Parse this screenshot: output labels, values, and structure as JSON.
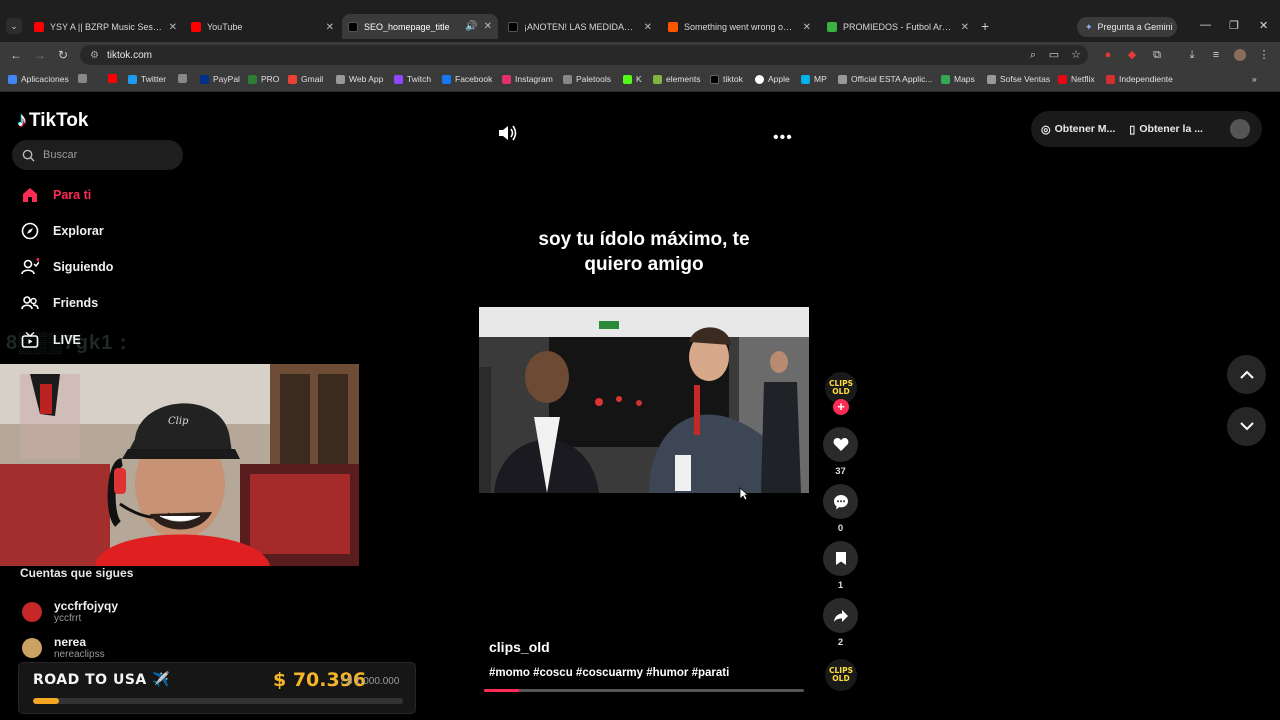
{
  "browser": {
    "tabs": [
      {
        "title": "YSY A || BZRP Music Sessions #...",
        "favicon_color": "#ff0000"
      },
      {
        "title": "YouTube",
        "favicon_color": "#ff0000"
      },
      {
        "title": "SEO_homepage_title",
        "favicon_color": "#000000",
        "active": true
      },
      {
        "title": "¡ANOTEN! LAS MEDIDAS QUE ...",
        "favicon_color": "#000000"
      },
      {
        "title": "Something went wrong on Sou...",
        "favicon_color": "#ff5500"
      },
      {
        "title": "PROMIEDOS - Futbol Argentino ...",
        "favicon_color": "#3cb043"
      }
    ],
    "new_tab": "+",
    "gemini_label": "Pregunta a Gemini",
    "url": "tiktok.com",
    "bookmarks": [
      {
        "label": "Aplicaciones",
        "color": "#4285f4"
      },
      {
        "label": "",
        "color": "#ff0000"
      },
      {
        "label": "Twitter",
        "color": "#1d9bf0"
      },
      {
        "label": "",
        "color": "#888888"
      },
      {
        "label": "PayPal",
        "color": "#003087"
      },
      {
        "label": "PRO",
        "color": "#2e7d32"
      },
      {
        "label": "Gmail",
        "color": "#ea4335"
      },
      {
        "label": "Web App",
        "color": "#999999"
      },
      {
        "label": "Twitch",
        "color": "#9146ff"
      },
      {
        "label": "Facebook",
        "color": "#1877f2"
      },
      {
        "label": "Instagram",
        "color": "#e1306c"
      },
      {
        "label": "Paletools",
        "color": "#888888"
      },
      {
        "label": "K",
        "color": "#53fc18"
      },
      {
        "label": "elements",
        "color": "#82b440"
      },
      {
        "label": "tiktok",
        "color": "#000000"
      },
      {
        "label": "Apple",
        "color": "#ffffff"
      },
      {
        "label": "MP",
        "color": "#00b1ea"
      },
      {
        "label": "Official ESTA Applic...",
        "color": "#999999"
      },
      {
        "label": "Maps",
        "color": "#34a853"
      },
      {
        "label": "Sofse Ventas",
        "color": "#999999"
      },
      {
        "label": "Netflix",
        "color": "#e50914"
      },
      {
        "label": "Independiente",
        "color": "#d32f2f"
      }
    ]
  },
  "sidebar": {
    "brand": "TikTok",
    "search_placeholder": "Buscar",
    "nav": [
      {
        "label": "Para ti",
        "icon": "home-icon"
      },
      {
        "label": "Explorar",
        "icon": "compass-icon"
      },
      {
        "label": "Siguiendo",
        "icon": "following-icon"
      },
      {
        "label": "Friends",
        "icon": "friends-icon"
      },
      {
        "label": "LIVE",
        "icon": "live-icon"
      }
    ],
    "ghost_overlay_text": "8▒▒▒7gk1 :",
    "following_title": "Cuentas que sigues",
    "following": [
      {
        "name": "yccfrfojyqy",
        "handle": "yccfrrt",
        "avatar_color": "#c62828"
      },
      {
        "name": "nerea",
        "handle": "nereaclipss",
        "avatar_color": "#c8a165"
      }
    ]
  },
  "stream_overlay": {
    "road_label": "ROAD TO USA ✈️",
    "amount": "$ 70.396",
    "goal": "/ $ 1.000.000",
    "progress_fraction": 0.07
  },
  "video": {
    "caption": "soy tu ídolo máximo, te quiero amigo",
    "author": "clips_old",
    "hashtags": "#momo #coscu #coscuarmy #humor #parati",
    "progress_fraction": 0.11,
    "creator_badge": "CLIPS OLD",
    "follow_plus": "+",
    "actions": [
      {
        "icon": "heart-icon",
        "count": "37"
      },
      {
        "icon": "comment-icon",
        "count": "0"
      },
      {
        "icon": "bookmark-icon",
        "count": "1"
      },
      {
        "icon": "share-icon",
        "count": "2"
      }
    ]
  },
  "topbar": {
    "get_coins": "Obtener M...",
    "get_app": "Obtener la ..."
  },
  "colors": {
    "accent": "#fe2c55",
    "overlay_gold": "#f5b52a"
  }
}
